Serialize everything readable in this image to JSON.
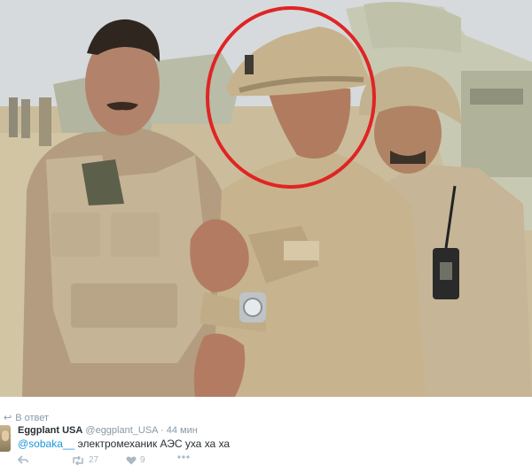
{
  "photo": {
    "alt": "",
    "highlight_color": "#e02424"
  },
  "tweet": {
    "reply_context": "В ответ",
    "author_name": "Eggplant USA",
    "author_handle": "@eggplant_USA",
    "separator": "·",
    "time": "44 мин",
    "mention": "@sobaka__",
    "text": "электромеханик АЭС уха ха ха",
    "actions": {
      "reply_icon": "reply-icon",
      "retweet_icon": "retweet-icon",
      "retweet_count": "27",
      "like_icon": "heart-icon",
      "like_count": "9",
      "more_icon": "more-icon"
    },
    "colors": {
      "link": "#1b95e0",
      "muted": "#8899a6",
      "text": "#292f33"
    }
  }
}
